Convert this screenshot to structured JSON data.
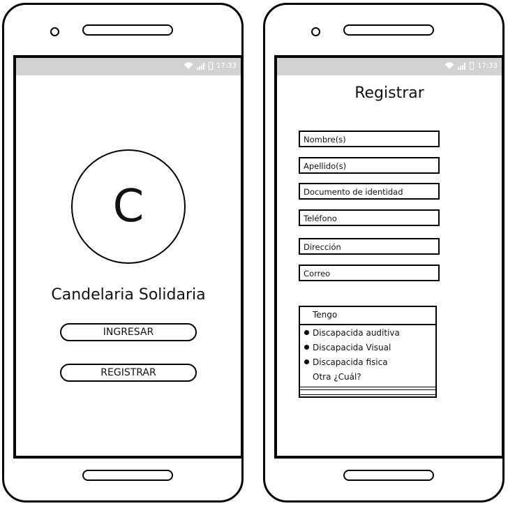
{
  "status_bar": {
    "time": "17:33"
  },
  "login_screen": {
    "logo_letter": "C",
    "app_name": "Candelaria Solidaria",
    "login_button": "INGRESAR",
    "register_button": "REGISTRAR"
  },
  "register_screen": {
    "title": "Registrar",
    "fields": [
      {
        "placeholder": "Nombre(s)"
      },
      {
        "placeholder": "Apellido(s)"
      },
      {
        "placeholder": "Documento de identidad"
      },
      {
        "placeholder": "Teléfono"
      },
      {
        "placeholder": "Dirección"
      },
      {
        "placeholder": "Correo"
      }
    ],
    "disability_list": {
      "header": "Tengo",
      "options": [
        "Discapacida auditiva",
        "Discapacida Visual",
        "Discapacida fisica"
      ],
      "other_option": "Otra ¿Cuál?"
    }
  }
}
